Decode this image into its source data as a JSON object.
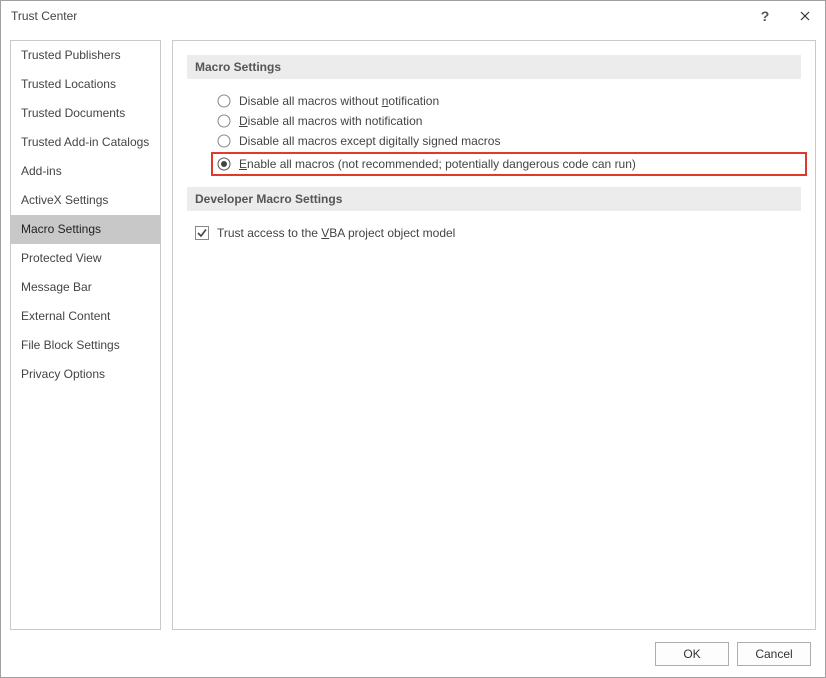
{
  "window": {
    "title": "Trust Center"
  },
  "sidebar": {
    "items": [
      {
        "label": "Trusted Publishers",
        "selected": false
      },
      {
        "label": "Trusted Locations",
        "selected": false
      },
      {
        "label": "Trusted Documents",
        "selected": false
      },
      {
        "label": "Trusted Add-in Catalogs",
        "selected": false
      },
      {
        "label": "Add-ins",
        "selected": false
      },
      {
        "label": "ActiveX Settings",
        "selected": false
      },
      {
        "label": "Macro Settings",
        "selected": true
      },
      {
        "label": "Protected View",
        "selected": false
      },
      {
        "label": "Message Bar",
        "selected": false
      },
      {
        "label": "External Content",
        "selected": false
      },
      {
        "label": "File Block Settings",
        "selected": false
      },
      {
        "label": "Privacy Options",
        "selected": false
      }
    ]
  },
  "macro": {
    "section_title": "Macro Settings",
    "opt1_pre": "Disable all macros without ",
    "opt1_acc": "n",
    "opt1_post": "otification",
    "opt2_acc": "D",
    "opt2_post": "isable all macros with notification",
    "opt3_pre": "Disable all macros except di",
    "opt3_acc": "g",
    "opt3_post": "itally signed macros",
    "opt4_acc": "E",
    "opt4_post": "nable all macros (not recommended; potentially dangerous code can run)",
    "selected_index": 3
  },
  "dev": {
    "section_title": "Developer Macro Settings",
    "trust_pre": "Trust access to the ",
    "trust_acc": "V",
    "trust_post": "BA project object model",
    "trust_checked": true
  },
  "footer": {
    "ok": "OK",
    "cancel": "Cancel"
  }
}
